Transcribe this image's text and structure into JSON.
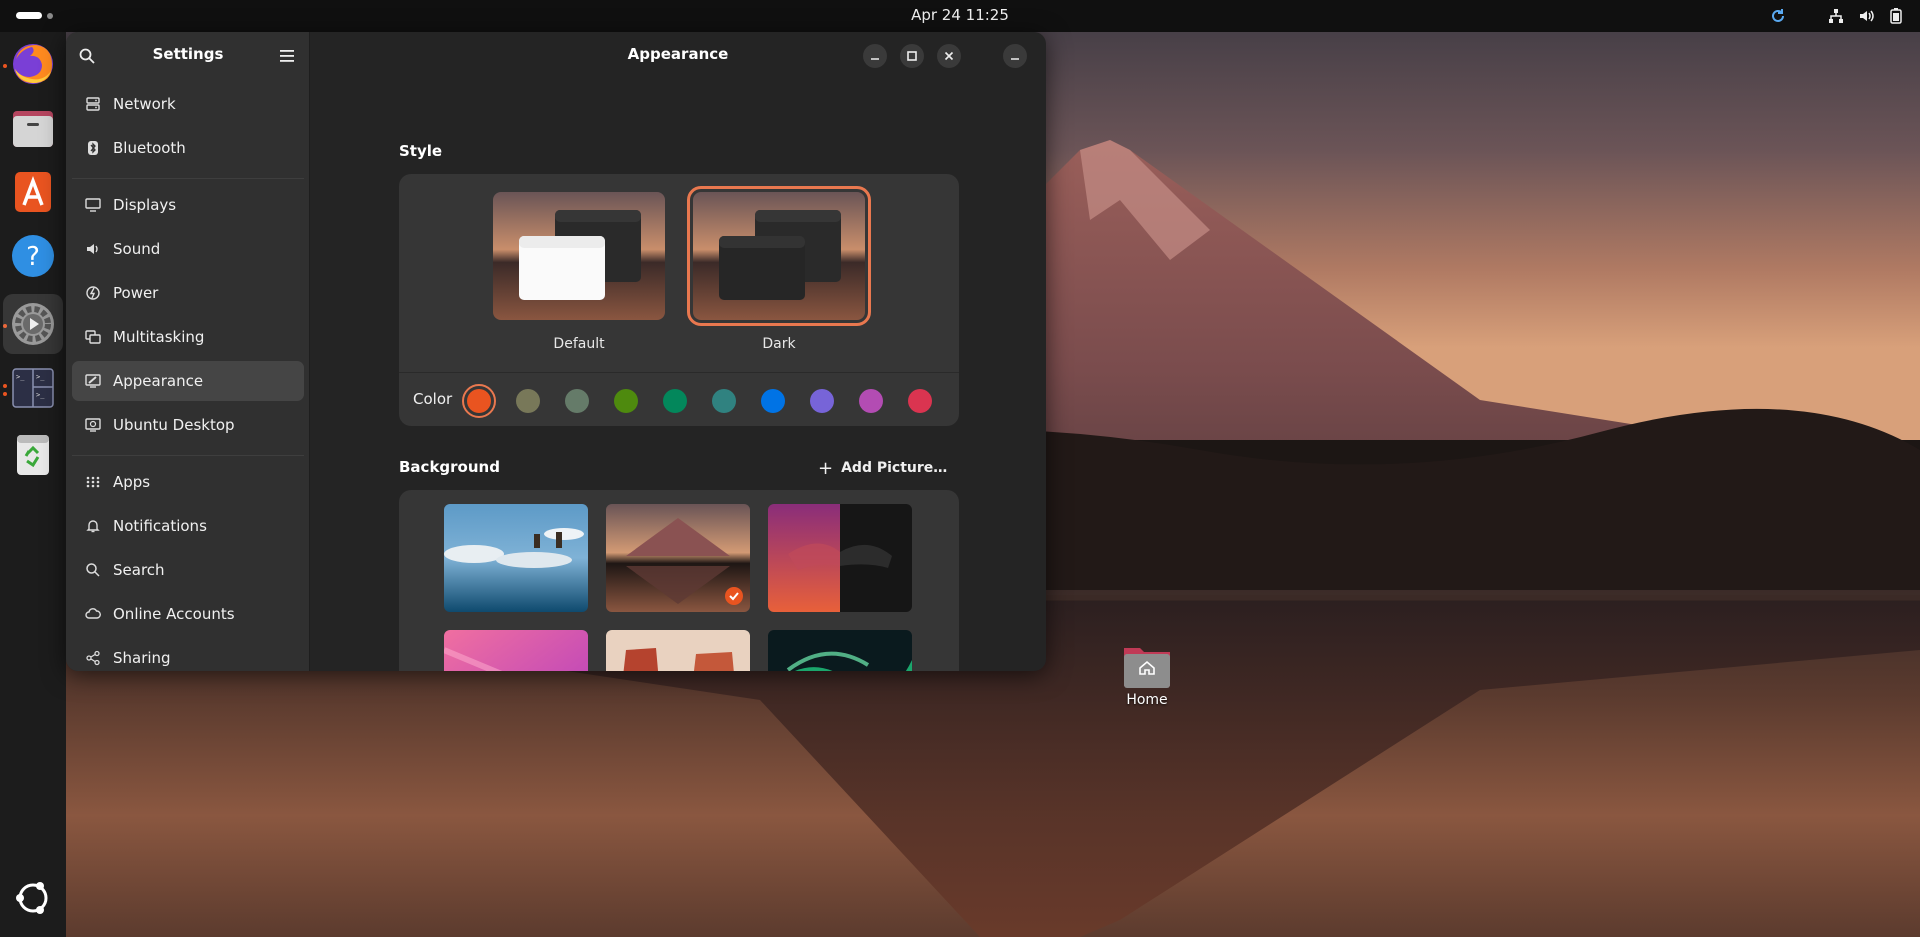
{
  "topbar": {
    "clock": "Apr 24  11:25",
    "tray_icons": [
      "refresh-icon",
      "network-icon",
      "volume-icon",
      "battery-icon"
    ]
  },
  "dock": {
    "apps": [
      {
        "name": "firefox-icon",
        "running": true
      },
      {
        "name": "files-icon",
        "running": false
      },
      {
        "name": "app-center-icon",
        "running": false
      },
      {
        "name": "help-icon",
        "running": false
      },
      {
        "name": "settings-icon",
        "running": true,
        "active": true
      },
      {
        "name": "terminal-icon",
        "running": true
      },
      {
        "name": "trash-icon",
        "running": false
      }
    ],
    "show_apps_icon": "ubuntu-logo-icon"
  },
  "window": {
    "sidebar_title": "Settings",
    "content_title": "Appearance",
    "nav_items": [
      {
        "id": "network",
        "label": "Network",
        "icon": "network-icon"
      },
      {
        "id": "bluetooth",
        "label": "Bluetooth",
        "icon": "bluetooth-icon"
      },
      {
        "id": "displays",
        "label": "Displays",
        "icon": "display-icon"
      },
      {
        "id": "sound",
        "label": "Sound",
        "icon": "speaker-icon"
      },
      {
        "id": "power",
        "label": "Power",
        "icon": "power-icon"
      },
      {
        "id": "multitasking",
        "label": "Multitasking",
        "icon": "multitasking-icon"
      },
      {
        "id": "appearance",
        "label": "Appearance",
        "icon": "appearance-icon",
        "selected": true
      },
      {
        "id": "ubuntu-desktop",
        "label": "Ubuntu Desktop",
        "icon": "ubuntu-desktop-icon"
      },
      {
        "id": "apps",
        "label": "Apps",
        "icon": "apps-grid-icon"
      },
      {
        "id": "notifications",
        "label": "Notifications",
        "icon": "bell-icon"
      },
      {
        "id": "search",
        "label": "Search",
        "icon": "search-icon"
      },
      {
        "id": "online-accounts",
        "label": "Online Accounts",
        "icon": "cloud-icon"
      },
      {
        "id": "sharing",
        "label": "Sharing",
        "icon": "share-icon"
      }
    ]
  },
  "appearance": {
    "style_heading": "Style",
    "style_options": [
      {
        "label": "Default",
        "selected": false
      },
      {
        "label": "Dark",
        "selected": true
      }
    ],
    "color_label": "Color",
    "accent_colors": [
      "#e95420",
      "#787859",
      "#657b69",
      "#4e8a0e",
      "#03875b",
      "#308280",
      "#0073e5",
      "#7764d8",
      "#b34cb3",
      "#da3450"
    ],
    "selected_accent": "#e95420",
    "background_heading": "Background",
    "add_picture_label": "Add Picture…",
    "backgrounds": [
      {
        "name": "clouds-reflection",
        "selected": false
      },
      {
        "name": "mountain-lake",
        "selected": true
      },
      {
        "name": "numbat-purple",
        "selected": false
      },
      {
        "name": "pink-abstract",
        "selected": false
      },
      {
        "name": "desert-canyon",
        "selected": false
      },
      {
        "name": "aurora",
        "selected": false
      }
    ]
  },
  "desktop": {
    "home_label": "Home"
  }
}
